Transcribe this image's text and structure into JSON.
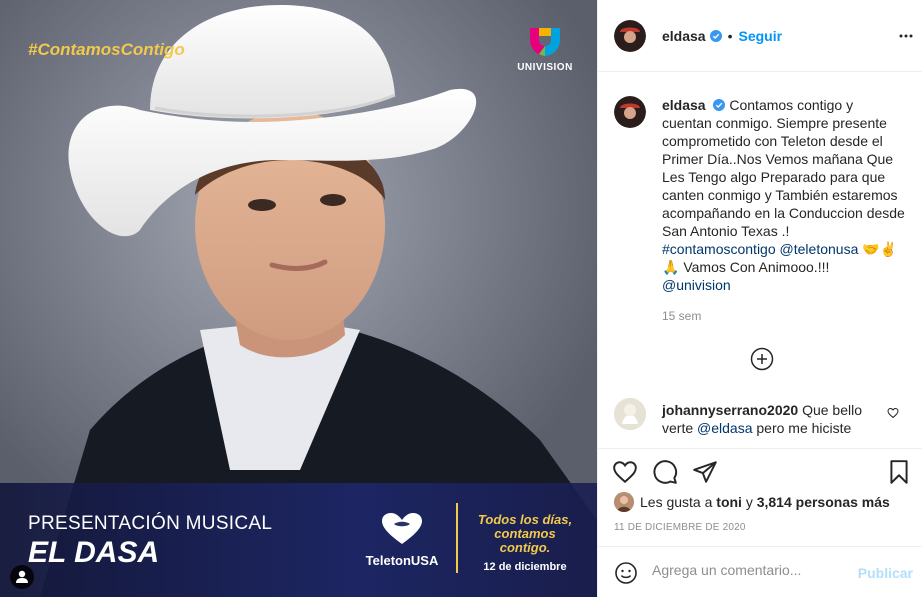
{
  "media": {
    "hashtag_a": "#Contamos",
    "hashtag_b": "Contigo",
    "network_logo_text": "UNIVISION",
    "banner_line1": "PRESENTACIÓN MUSICAL",
    "banner_line2": "EL DASA",
    "teleton_name": "TeletonUSA",
    "slogan_a": "Todos los días,",
    "slogan_b": "contamos contigo.",
    "slogan_date": "12 de diciembre",
    "icons": [
      "user-tag-icon",
      "teleton-heart-icon",
      "univision-logo-icon"
    ]
  },
  "header": {
    "username": "eldasa",
    "dot": "•",
    "follow_label": "Seguir",
    "more_icon": "more-options-icon"
  },
  "caption": {
    "username": "eldasa",
    "text": "Contamos contigo y cuentan conmigo. Siempre presente comprometido con Teleton desde el Primer Día..Nos Vemos mañana Que Les Tengo algo Preparado para que canten conmigo y También estaremos acompañando en la Conduccion desde San Antonio Texas .!",
    "hashtag": "#contamoscontigo",
    "mention1": "@teletonusa",
    "emoji1": "🤝✌️",
    "line2_emoji": "🙏",
    "line2_text": "Vamos Con Animooo.!!!",
    "mention2": "@univision",
    "time": "15 sem"
  },
  "comment": {
    "username": "johannyserrano2020",
    "text_a": "Que bello verte",
    "mention": "@eldasa",
    "text_b": "pero me hiciste"
  },
  "likes": {
    "prefix": "Les gusta a",
    "user": "toni",
    "connector": "y",
    "count": "3,814 personas más"
  },
  "date": "11 DE DICIEMBRE DE 2020",
  "add_comment": {
    "placeholder": "Agrega un comentario...",
    "publish_label": "Publicar"
  },
  "colors": {
    "accent": "#0095f6",
    "link": "#00376b",
    "muted": "#8e8e8e",
    "brand_yellow": "#f2c94c"
  }
}
